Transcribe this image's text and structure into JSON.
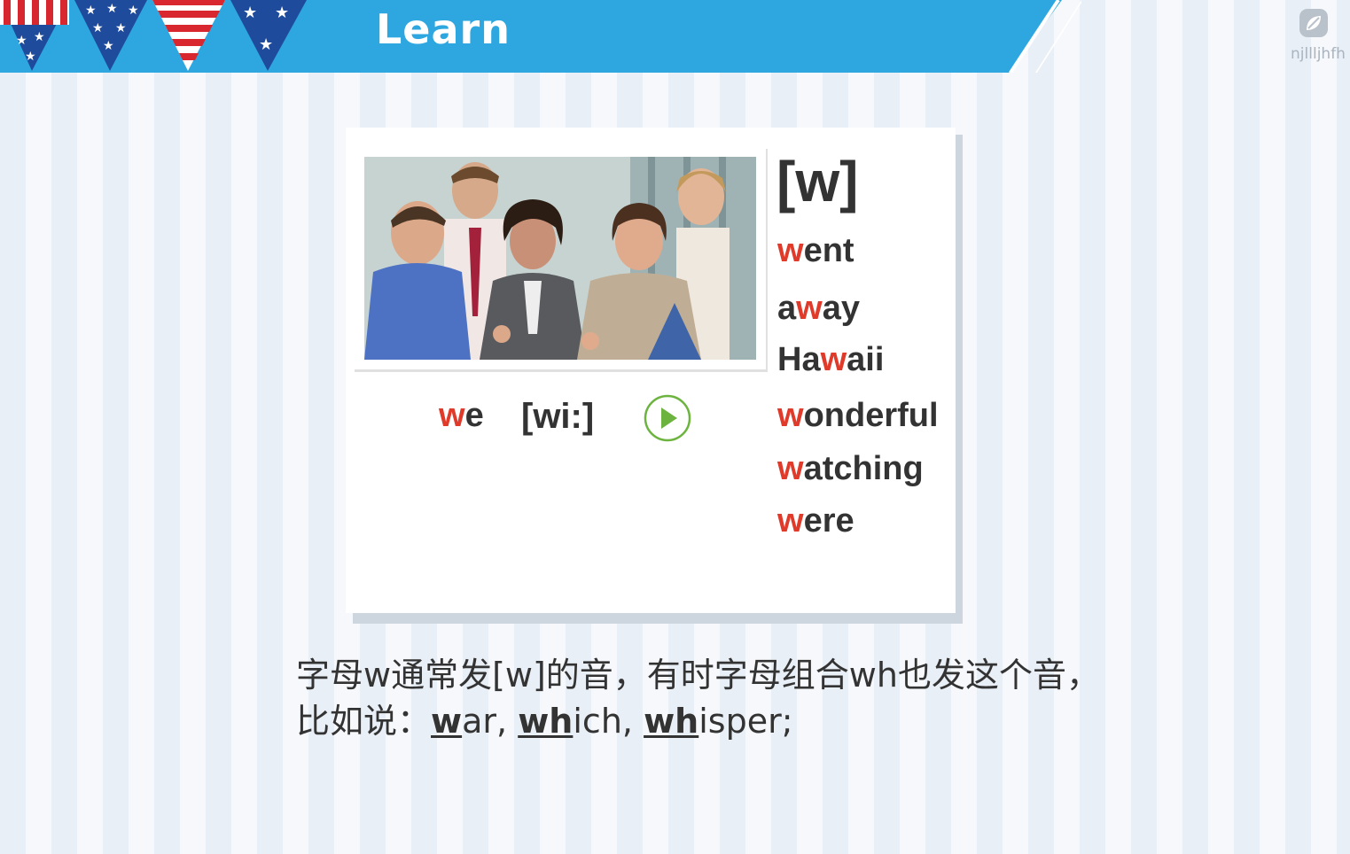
{
  "banner": {
    "title": "Learn",
    "bg_color": "#2ea7e0"
  },
  "logo": {
    "icon": "leaf-logo-icon",
    "text": "njllljhfh"
  },
  "card": {
    "photo": {
      "icon": "group-of-people-photo"
    },
    "example": {
      "word_highlight": "w",
      "word_rest": "e",
      "phonetic": "[wi:]",
      "play_icon": "play-icon"
    },
    "phoneme": "[w]",
    "words": [
      {
        "pre": "",
        "hl": "w",
        "post": "ent"
      },
      {
        "pre": "a",
        "hl": "w",
        "post": "ay"
      },
      {
        "pre": "Ha",
        "hl": "w",
        "post": "aii"
      },
      {
        "pre": "",
        "hl": "w",
        "post": "onderful"
      },
      {
        "pre": "",
        "hl": "w",
        "post": "atching"
      },
      {
        "pre": "",
        "hl": "w",
        "post": "ere"
      }
    ]
  },
  "description": {
    "line1": "字母w通常发[w]的音，有时字母组合wh也发这个音，",
    "line2_prefix": "比如说：",
    "ex1_u": "w",
    "ex1_rest": "ar, ",
    "ex2_u": "wh",
    "ex2_rest": "ich, ",
    "ex3_u": "wh",
    "ex3_rest": "isper;"
  },
  "colors": {
    "highlight": "#e03a2a",
    "text": "#333333",
    "play_green": "#6cb43f"
  }
}
